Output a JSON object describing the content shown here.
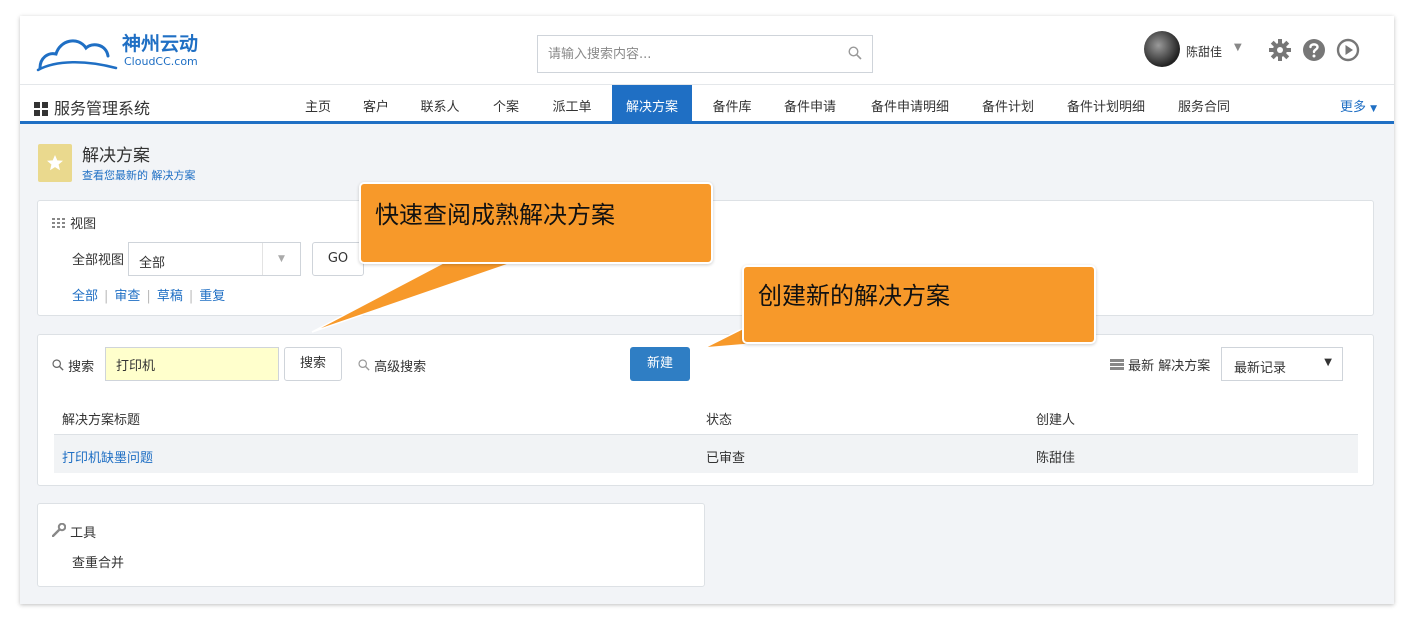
{
  "brand": {
    "name": "神州云动",
    "sub": "CloudCC.com"
  },
  "search": {
    "placeholder": "请输入搜索内容..."
  },
  "user": {
    "name": "陈甜佳"
  },
  "app_name": "服务管理系统",
  "nav": {
    "tabs": [
      {
        "label": "主页",
        "active": false
      },
      {
        "label": "客户",
        "active": false
      },
      {
        "label": "联系人",
        "active": false
      },
      {
        "label": "个案",
        "active": false
      },
      {
        "label": "派工单",
        "active": false
      },
      {
        "label": "解决方案",
        "active": true
      },
      {
        "label": "备件库",
        "active": false
      },
      {
        "label": "备件申请",
        "active": false
      },
      {
        "label": "备件申请明细",
        "active": false
      },
      {
        "label": "备件计划",
        "active": false
      },
      {
        "label": "备件计划明细",
        "active": false
      },
      {
        "label": "服务合同",
        "active": false
      }
    ],
    "more": "更多"
  },
  "page": {
    "title": "解决方案",
    "subtitle": "查看您最新的 解决方案"
  },
  "view_panel": {
    "heading": "视图",
    "label": "全部视图",
    "selected": "全部",
    "go": "GO",
    "filters": [
      "全部",
      "审查",
      "草稿",
      "重复"
    ]
  },
  "search_panel": {
    "label": "搜索",
    "keyword": "打印机",
    "search_button": "搜索",
    "advanced": "高级搜索",
    "new_button": "新建",
    "recent_label": "最新 解决方案",
    "sort": "最新记录",
    "columns": [
      "解决方案标题",
      "状态",
      "创建人"
    ],
    "rows": [
      {
        "title": "打印机缺墨问题",
        "status": "已审查",
        "creator": "陈甜佳"
      }
    ]
  },
  "tools_panel": {
    "heading": "工具",
    "item": "查重合并"
  },
  "callouts": {
    "quick_view": "快速查阅成熟解决方案",
    "create_new": "创建新的解决方案"
  },
  "colors": {
    "brand_blue": "#1f6fc4",
    "button_blue": "#2f7ec4",
    "callout_orange": "#f7992a",
    "title_icon_bg": "#ead98e"
  }
}
